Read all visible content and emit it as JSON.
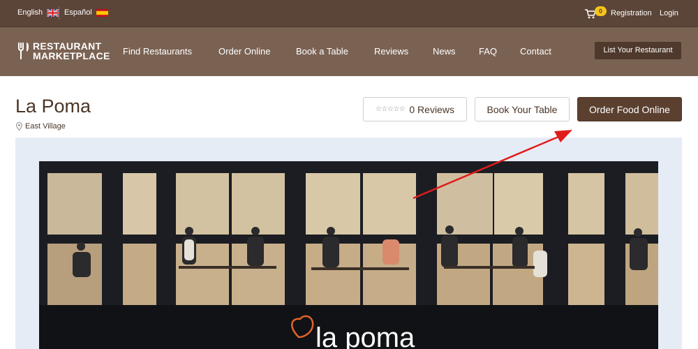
{
  "topbar": {
    "lang_en": "English",
    "lang_es": "Español",
    "cart_count": "0",
    "registration": "Registration",
    "login": "Login"
  },
  "brand": {
    "line1": "RESTAURANT",
    "line2": "MARKETPLACE"
  },
  "nav": {
    "items": [
      "Find Restaurants",
      "Order Online",
      "Book a Table",
      "Reviews",
      "News",
      "FAQ",
      "Contact"
    ],
    "cta": "List Your Restaurant"
  },
  "restaurant": {
    "name": "La Poma",
    "location": "East Village",
    "reviews_label": "0 Reviews",
    "rating": 0,
    "book_label": "Book Your Table",
    "order_label": "Order Food Online"
  },
  "photo": {
    "signage": "la poma"
  },
  "colors": {
    "topbar": "#5b4538",
    "navbar": "#7a6253",
    "primary_button": "#5b4030",
    "badge": "#f5c518",
    "annotation_arrow": "#e11b1b",
    "panel": "#e6ecf5"
  },
  "icons": [
    "uk-flag-icon",
    "spain-flag-icon",
    "cart-icon",
    "fork-knife-icon",
    "map-pin-icon",
    "star-icon"
  ]
}
